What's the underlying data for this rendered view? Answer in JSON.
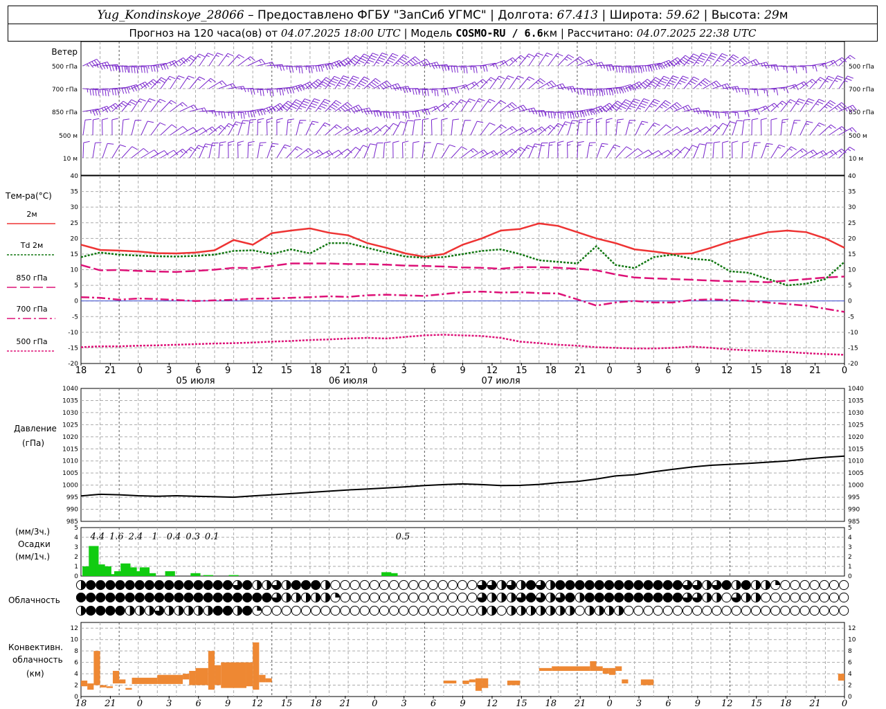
{
  "header": {
    "station": "Yug_Kondinskoye_28066",
    "provider": "– Предоставлено ФГБУ \"ЗапСиб УГМС\"",
    "lon_label": "Долгота:",
    "lon": "67.413",
    "lat_label": "Широта:",
    "lat": "59.62",
    "alt_label": "Высота:",
    "alt": "29",
    "alt_unit": "м",
    "forecast_label": "Прогноз на 120 часа(ов) от",
    "forecast_from": "04.07.2025 18:00 UTC",
    "model_label": "Модель",
    "model": "COSMO-RU / 6.6",
    "model_unit": "км",
    "calc_label": "Рассчитано:",
    "calc_time": "04.07.2025 22:38 UTC"
  },
  "labels": {
    "wind": "Ветер",
    "wind_levels": [
      "500 гПа",
      "700 гПа",
      "850 гПа",
      "500 м",
      "10 м"
    ],
    "temp": "Тем-ра(°C)",
    "pressure": "Давление",
    "pressure_unit": "(гПа)",
    "precip_top": "(мм/3ч.)",
    "precip": "Осадки",
    "precip_unit": "(мм/1ч.)",
    "cloud": "Облачность",
    "conv1": "Конвективн.",
    "conv2": "облачность",
    "conv3": "(км)"
  },
  "legend": [
    {
      "text": "2м",
      "color": "#ee3333",
      "dash": ""
    },
    {
      "text": "Td  2м",
      "color": "#117711",
      "dash": "3,2"
    },
    {
      "text": "850 гПа",
      "color": "#dd1177",
      "dash": "14,5"
    },
    {
      "text": "700 гПа",
      "color": "#dd1177",
      "dash": "12,4,3,4"
    },
    {
      "text": "500 гПа",
      "color": "#dd1177",
      "dash": "3,2"
    }
  ],
  "axis": {
    "hours": [
      "18",
      "21",
      "0",
      "3",
      "6",
      "9",
      "12",
      "15",
      "18",
      "21",
      "0",
      "3",
      "6",
      "9",
      "12",
      "15",
      "18",
      "21",
      "0",
      "3",
      "6",
      "9",
      "12",
      "15",
      "18",
      "21",
      "0"
    ],
    "days": [
      "05 июля",
      "06 июля",
      "07 июля"
    ]
  },
  "chart_data": [
    {
      "type": "line",
      "title": "Тем-ра(°C)",
      "ylim": [
        -20,
        40
      ],
      "x_hours": [
        0,
        3,
        6,
        9,
        12,
        15,
        18,
        21,
        24,
        27,
        30,
        33,
        36,
        39,
        42,
        45,
        48,
        51,
        54,
        57,
        60,
        63,
        66,
        69,
        72,
        75,
        78,
        81,
        84,
        87,
        90,
        93,
        96,
        99,
        102,
        105,
        108,
        111,
        114,
        117,
        120
      ],
      "series": [
        {
          "name": "2м",
          "color": "#ee3333",
          "values": [
            18.0,
            16.3,
            16.1,
            15.8,
            15.3,
            15.2,
            15.5,
            16.2,
            19.5,
            18.0,
            21.7,
            22.5,
            23.2,
            21.8,
            21.0,
            18.5,
            17.0,
            15.2,
            14.1,
            15.0,
            18.0,
            20.0,
            22.5,
            23.0,
            24.8,
            24.0,
            22.0,
            20.0,
            18.5,
            16.5,
            15.8,
            15.0,
            15.2,
            17.0,
            19.0,
            20.5,
            22.0,
            22.5,
            22.0,
            20.0,
            17.0
          ]
        },
        {
          "name": "Td  2м",
          "color": "#117711",
          "values": [
            14.0,
            15.5,
            14.8,
            14.5,
            14.3,
            14.2,
            14.4,
            14.8,
            16.0,
            16.2,
            15.0,
            16.5,
            15.2,
            18.5,
            18.5,
            17.0,
            15.5,
            14.2,
            13.8,
            14.0,
            15.0,
            16.0,
            16.5,
            15.0,
            13.0,
            12.5,
            12.0,
            17.5,
            11.5,
            10.5,
            14.0,
            14.8,
            13.5,
            13.0,
            9.5,
            9.0,
            7.0,
            5.0,
            5.5,
            7.0,
            12.5
          ]
        },
        {
          "name": "850 гПа",
          "color": "#dd1177",
          "values": [
            11.5,
            9.8,
            9.9,
            9.6,
            9.4,
            9.3,
            9.6,
            10.0,
            10.6,
            10.5,
            11.2,
            12.0,
            12.0,
            12.0,
            11.8,
            11.8,
            11.6,
            11.3,
            11.2,
            11.0,
            10.7,
            10.6,
            10.3,
            10.8,
            10.8,
            10.6,
            10.3,
            9.8,
            8.5,
            7.5,
            7.2,
            7.0,
            6.8,
            6.5,
            6.3,
            6.2,
            6.0,
            6.5,
            7.0,
            7.5,
            7.8
          ]
        },
        {
          "name": "700 гПа",
          "color": "#dd1177",
          "values": [
            1.2,
            1.0,
            0.4,
            0.8,
            0.6,
            0.3,
            0.0,
            0.2,
            0.4,
            0.7,
            0.8,
            1.0,
            1.2,
            1.5,
            1.3,
            1.8,
            2.0,
            1.8,
            1.6,
            2.2,
            2.8,
            3.0,
            2.7,
            2.8,
            2.5,
            2.4,
            0.5,
            -1.5,
            -0.5,
            0.0,
            -0.5,
            -0.5,
            0.3,
            0.5,
            0.3,
            0.0,
            -0.5,
            -1.0,
            -1.5,
            -2.5,
            -3.5
          ]
        },
        {
          "name": "500 гПа",
          "color": "#dd1177",
          "values": [
            -14.8,
            -14.5,
            -14.5,
            -14.3,
            -14.2,
            -14.0,
            -13.8,
            -13.6,
            -13.5,
            -13.3,
            -13.0,
            -12.8,
            -12.5,
            -12.3,
            -12.0,
            -11.8,
            -12.0,
            -11.5,
            -11.0,
            -10.8,
            -11.0,
            -11.2,
            -11.8,
            -13.0,
            -13.5,
            -14.0,
            -14.3,
            -14.8,
            -15.0,
            -15.2,
            -15.2,
            -15.0,
            -14.6,
            -15.0,
            -15.5,
            -15.8,
            -16.0,
            -16.3,
            -16.7,
            -17.0,
            -17.2
          ]
        }
      ]
    },
    {
      "type": "line",
      "title": "Давление",
      "ylabel": "(гПа)",
      "ylim": [
        985,
        1040
      ],
      "x_hours": [
        0,
        3,
        6,
        9,
        12,
        15,
        18,
        21,
        24,
        27,
        30,
        33,
        36,
        39,
        42,
        45,
        48,
        51,
        54,
        57,
        60,
        63,
        66,
        69,
        72,
        75,
        78,
        81,
        84,
        87,
        90,
        93,
        96,
        99,
        102,
        105,
        108,
        111,
        114,
        117,
        120
      ],
      "series": [
        {
          "name": "",
          "color": "#000000",
          "values": [
            995.5,
            996.2,
            996.0,
            995.6,
            995.4,
            995.6,
            995.4,
            995.2,
            995.0,
            995.5,
            996.0,
            996.5,
            997.0,
            997.5,
            998.0,
            998.4,
            998.8,
            999.3,
            999.8,
            1000.2,
            1000.5,
            1000.2,
            999.8,
            999.9,
            1000.3,
            1001.0,
            1001.5,
            1002.5,
            1003.8,
            1004.3,
            1005.5,
            1006.5,
            1007.5,
            1008.2,
            1008.6,
            1009.0,
            1009.5,
            1010.0,
            1010.8,
            1011.5,
            1012.0
          ]
        }
      ]
    },
    {
      "type": "bar",
      "title": "Осадки",
      "ylabel": "(мм/1ч.)",
      "ylim": [
        0,
        5
      ],
      "x_hours": [
        1,
        2,
        3,
        4,
        5,
        6,
        7,
        8,
        9,
        10,
        11,
        14,
        18,
        20,
        24,
        48,
        49
      ],
      "values": [
        1.0,
        3.1,
        1.2,
        1.0,
        0.2,
        0.5,
        1.3,
        0.9,
        0.5,
        0.9,
        0.3,
        0.5,
        0.3,
        0.1,
        0.1,
        0.4,
        0.3
      ],
      "totals": [
        "4.4",
        "1.6",
        "2.4",
        "1",
        "0.4",
        "0.3",
        "0.1",
        "0.5"
      ],
      "color": "#11cc11"
    },
    {
      "type": "table",
      "title": "Облачность",
      "rows": [
        [
          0.5,
          1,
          1,
          1,
          1,
          1,
          1,
          1,
          1,
          1,
          1,
          1,
          1,
          1,
          1,
          1,
          0.75,
          1,
          0.5,
          0.5,
          0.75,
          0.5,
          1,
          1,
          1,
          0.5,
          0,
          0,
          0,
          0,
          0,
          0,
          0,
          0,
          0,
          0,
          0,
          0,
          0,
          0,
          0,
          0.75,
          0.75,
          0.5,
          0.75,
          0.5,
          1,
          0.75,
          0.5,
          1,
          1,
          1,
          1,
          1,
          1,
          1,
          1,
          1,
          1,
          1,
          1,
          1,
          0.75,
          0.75,
          0.5,
          0.75,
          1,
          0.5,
          1,
          0.5,
          0.5,
          0.25,
          0,
          0,
          0,
          0,
          0,
          0,
          0,
          0,
          0,
          0,
          0,
          0,
          0,
          0,
          0.75,
          0.75,
          0.5,
          0.75,
          0.5,
          0.5,
          0,
          0,
          0,
          0,
          0,
          0,
          0,
          0,
          0,
          0,
          0,
          0,
          0,
          0,
          0,
          0,
          0,
          0,
          0,
          0,
          0,
          0,
          0,
          0,
          0,
          0,
          0,
          0,
          0,
          0
        ],
        [
          1,
          1,
          1,
          1,
          1,
          1,
          1,
          1,
          1,
          1,
          1,
          1,
          1,
          1,
          1,
          1,
          1,
          1,
          1,
          1,
          0.75,
          0.5,
          0.5,
          0.5,
          0.5,
          0.5,
          0.25,
          0,
          0,
          0,
          0,
          0,
          0,
          0,
          0,
          0,
          0,
          0,
          0,
          0,
          0,
          0.75,
          0.5,
          0.5,
          0.5,
          0.75,
          1,
          0.75,
          0.5,
          0.75,
          1,
          0.5,
          1,
          1,
          1,
          1,
          1,
          1,
          1,
          1,
          1,
          1,
          0.75,
          0.75,
          0.5,
          0.5,
          0,
          0.75,
          0.5,
          0.5,
          0,
          0,
          0,
          0,
          0,
          0,
          0,
          0,
          0,
          0,
          0,
          0,
          0,
          0,
          0,
          0,
          0.75,
          0.5,
          0.5,
          0.5,
          1,
          0.75,
          0.5,
          1,
          0.75,
          0.5,
          0.5,
          0.5,
          0,
          0,
          0,
          0,
          0,
          0,
          0,
          0,
          0,
          0,
          0,
          0,
          0,
          0,
          0,
          0,
          0,
          0,
          0,
          0,
          0,
          0,
          0,
          0,
          0,
          0
        ],
        [
          0.5,
          1,
          1,
          1,
          1,
          0.5,
          0.5,
          0.5,
          0.75,
          0.5,
          0.5,
          0.5,
          0.5,
          0.5,
          1,
          1,
          0.5,
          1,
          0.25,
          0,
          0,
          0,
          0,
          0,
          0,
          0,
          0,
          0,
          0,
          0,
          0,
          0,
          0,
          0,
          0,
          0,
          0,
          0,
          0,
          0,
          0,
          0.5,
          0.5,
          0,
          0.5,
          0.5,
          0.5,
          0.5,
          0.5,
          0.5,
          0.5,
          0,
          0.5,
          0.5,
          0.5,
          0.5,
          0,
          0,
          0,
          0,
          0,
          0,
          0,
          0,
          0,
          0,
          0,
          0,
          0,
          0,
          0,
          0,
          0,
          0,
          0,
          0,
          0,
          0,
          0,
          0,
          0,
          0,
          0,
          0,
          0,
          0.75,
          1,
          0.5,
          0,
          0,
          0,
          0,
          0,
          0,
          0,
          0,
          0,
          0,
          0,
          0,
          0,
          0,
          0,
          0,
          0,
          0,
          0,
          0,
          0,
          0,
          0,
          0,
          0,
          0,
          0,
          0,
          0,
          0,
          0,
          0,
          0,
          0,
          0,
          0,
          0
        ]
      ]
    },
    {
      "type": "bar",
      "title": "Конвективн. облачность",
      "ylabel": "(км)",
      "ylim": [
        0,
        13
      ],
      "color": "#ee8833",
      "segments": [
        [
          0,
          1,
          1.8,
          2.8
        ],
        [
          1,
          2,
          1.2,
          2.3
        ],
        [
          2,
          3,
          2.0,
          8.0
        ],
        [
          3,
          4,
          1.6,
          2.0
        ],
        [
          4,
          5,
          1.5,
          1.8
        ],
        [
          5,
          6,
          2.3,
          4.5
        ],
        [
          6,
          7,
          2.3,
          3.0
        ],
        [
          7,
          8,
          1.2,
          1.5
        ],
        [
          8,
          12,
          2.2,
          3.3
        ],
        [
          12,
          16,
          2.2,
          3.8
        ],
        [
          16,
          17,
          3.0,
          4.0
        ],
        [
          17,
          18,
          2.0,
          4.5
        ],
        [
          18,
          20,
          2.0,
          5.0
        ],
        [
          20,
          21,
          1.2,
          8.0
        ],
        [
          21,
          22,
          2.0,
          5.5
        ],
        [
          22,
          26,
          1.5,
          6.0
        ],
        [
          26,
          27,
          1.8,
          6.0
        ],
        [
          27,
          28,
          1.2,
          9.5
        ],
        [
          28,
          29,
          2.5,
          3.8
        ],
        [
          29,
          30,
          2.5,
          3.2
        ],
        [
          57,
          59,
          2.3,
          2.8
        ],
        [
          60,
          61,
          2.2,
          2.8
        ],
        [
          61,
          62,
          2.5,
          3.0
        ],
        [
          62,
          63,
          1.0,
          3.2
        ],
        [
          63,
          64,
          1.5,
          3.2
        ],
        [
          67,
          69,
          2.0,
          2.8
        ],
        [
          72,
          74,
          4.5,
          5.0
        ],
        [
          74,
          80,
          4.5,
          5.3
        ],
        [
          80,
          81,
          4.5,
          6.2
        ],
        [
          81,
          82,
          4.5,
          5.3
        ],
        [
          82,
          83,
          4.0,
          5.0
        ],
        [
          83,
          84,
          3.8,
          5.0
        ],
        [
          84,
          85,
          4.5,
          5.3
        ],
        [
          85,
          86,
          2.3,
          3.0
        ],
        [
          88,
          90,
          2.0,
          3.0
        ],
        [
          119,
          120,
          2.8,
          4.0
        ]
      ]
    }
  ]
}
